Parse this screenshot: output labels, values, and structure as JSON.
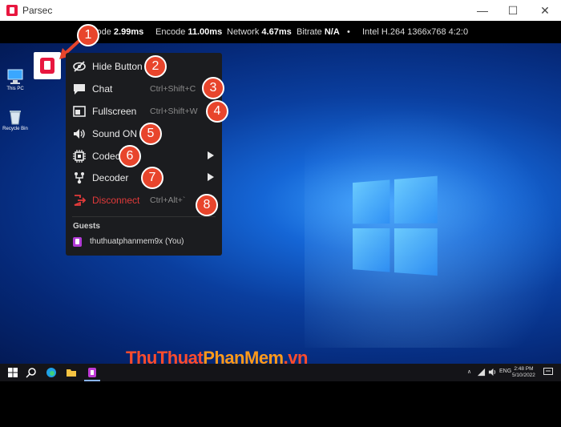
{
  "titlebar": {
    "title": "Parsec",
    "minimize": "—",
    "maximize": "☐",
    "close": "✕"
  },
  "stats": [
    {
      "label": "code",
      "value": "2.99ms"
    },
    {
      "label": "Encode",
      "value": "11.00ms"
    },
    {
      "label": "Network",
      "value": "4.67ms"
    },
    {
      "label": "Bitrate",
      "value": "N/A"
    },
    {
      "label": "•",
      "value": ""
    },
    {
      "label": "Intel H.264 1366x768 4:2:0",
      "value": ""
    }
  ],
  "desktop": {
    "icons": [
      {
        "label": "This PC"
      },
      {
        "label": "Recycle Bin"
      }
    ]
  },
  "menu": {
    "items": [
      {
        "label": "Hide Button",
        "shortcut": "",
        "submenu": false,
        "icon": "eye-off-icon"
      },
      {
        "label": "Chat",
        "shortcut": "Ctrl+Shift+C",
        "submenu": false,
        "icon": "chat-icon"
      },
      {
        "label": "Fullscreen",
        "shortcut": "Ctrl+Shift+W",
        "submenu": false,
        "icon": "fullscreen-icon"
      },
      {
        "label": "Sound ON",
        "shortcut": "",
        "submenu": false,
        "icon": "speaker-icon"
      },
      {
        "label": "Codec",
        "shortcut": "",
        "submenu": true,
        "icon": "chip-icon"
      },
      {
        "label": "Decoder",
        "shortcut": "",
        "submenu": true,
        "icon": "decoder-icon"
      },
      {
        "label": "Disconnect",
        "shortcut": "Ctrl+Alt+`",
        "submenu": false,
        "icon": "disconnect-icon"
      }
    ],
    "guests_heading": "Guests",
    "guest_name": "thuthuatphanmem9x (You)"
  },
  "badges": [
    "1",
    "2",
    "3",
    "4",
    "5",
    "6",
    "7",
    "8"
  ],
  "watermark": {
    "part1": "ThuThuat",
    "part2": "PhanMem",
    "part3": ".vn"
  },
  "taskbar": {
    "tray_lang": "ENG",
    "time": "2:48 PM",
    "date": "5/10/2022",
    "tray_chevron": "∧"
  },
  "colors": {
    "accent_red": "#e8173f",
    "badge_orange": "#e8452c",
    "disconnect_red": "#e23a3a",
    "menu_bg": "#1b1c1f"
  }
}
